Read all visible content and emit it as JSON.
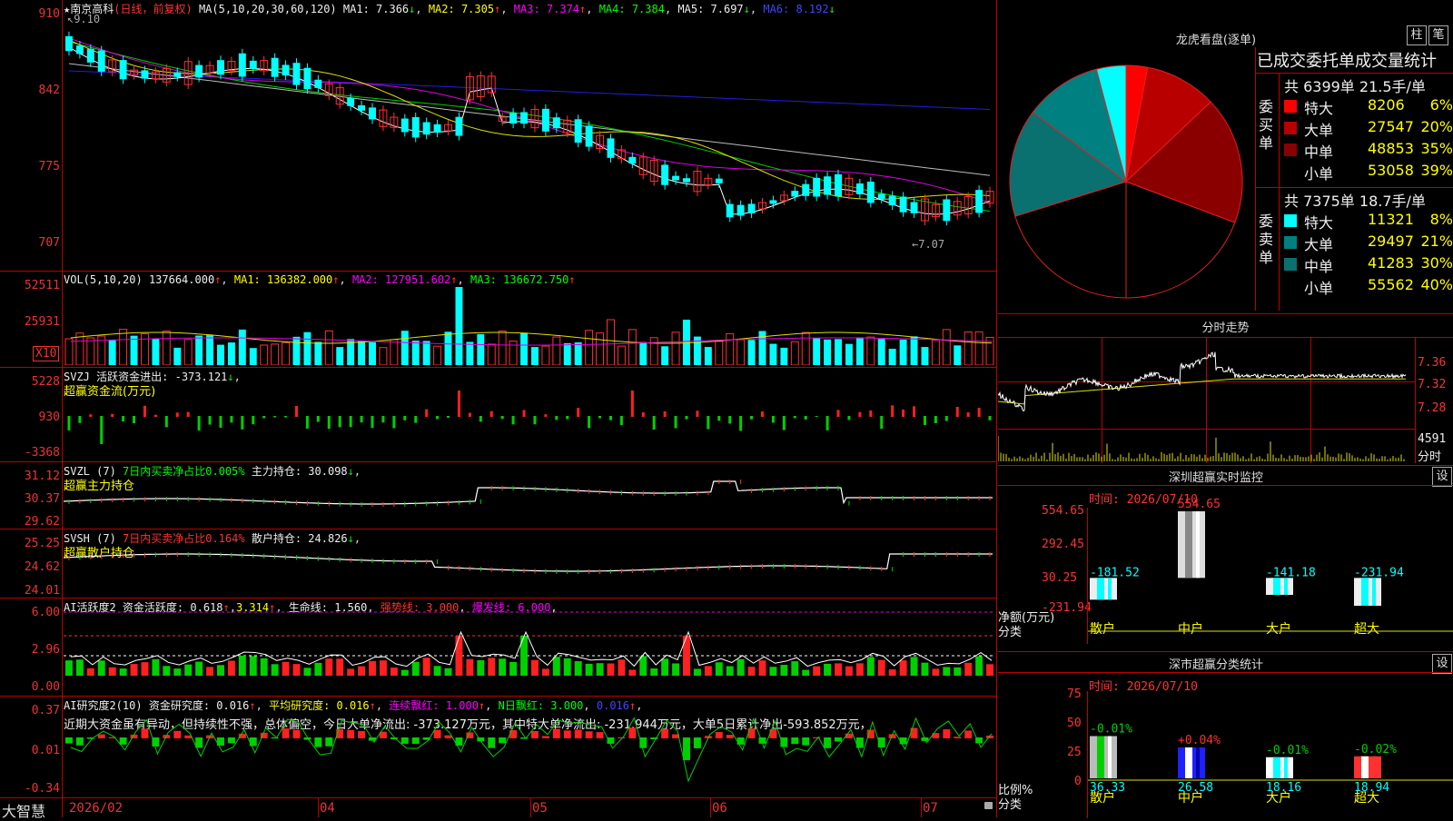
{
  "main_chart": {
    "star": "★",
    "stock_name": "南京高科",
    "period_label": "(日线，前复权)",
    "ma_params": "MA(5,10,20,30,60,120)",
    "ma1": "MA1: 7.366",
    "ma2": "MA2: 7.305",
    "ma3": "MA3: 7.374",
    "ma4": "MA4: 7.384",
    "ma5": "MA5: 7.697",
    "ma6": "MA6: 8.192",
    "high_mark": "9.10",
    "low_mark": "7.07",
    "y_ticks": [
      "910",
      "842",
      "775",
      "707"
    ]
  },
  "vol_chart": {
    "label": "VOL(5,10,20)",
    "value": "137664.000",
    "ma1": "MA1: 136382.000",
    "ma2": "MA2: 127951.602",
    "ma3": "MA3: 136672.750",
    "y_ticks": [
      "52511",
      "25931"
    ],
    "unit": "X10"
  },
  "svzj": {
    "label": "SVZJ",
    "text": "活跃资金进出: -373.121",
    "subtitle": "超赢资金流(万元)",
    "y_ticks": [
      "5228",
      "930",
      "-3368"
    ]
  },
  "svzl": {
    "label": "SVZL (7)",
    "text1": "7日内买卖净占比0.005%",
    "text2": "主力持仓: 30.098",
    "subtitle": "超赢主力持仓",
    "y_ticks": [
      "31.12",
      "30.37",
      "29.62"
    ]
  },
  "svsh": {
    "label": "SVSH (7)",
    "text1": "7日内买卖净占比0.164%",
    "text2": "散户持仓: 24.826",
    "subtitle": "超赢散户持仓",
    "y_ticks": [
      "25.25",
      "24.62",
      "24.01"
    ]
  },
  "ai_active": {
    "label": "AI活跃度2",
    "text1": "资金活跃度: 0.618",
    "text2": "3.314",
    "text3": "生命线: 1.560",
    "text4": "强势线: 3.000",
    "text5": "爆发线: 6.000",
    "y_ticks": [
      "6.00",
      "2.96",
      "0.00"
    ]
  },
  "ai_research": {
    "label": "AI研究度2(10)",
    "text1": "资金研究度: 0.016",
    "text2": "平均研究度: 0.016",
    "text3": "连续飘红: 1.000",
    "text4": "N日飘红: 3.000",
    "text5": "0.016",
    "commentary": "近期大资金虽有异动，但持续性不强，总体偏空，今日大单净流出: -373.127万元，其中特大单净流出: -231.944万元，大单5日累计净出-593.852万元，",
    "y_ticks": [
      "0.37",
      "0.01",
      "-0.34"
    ]
  },
  "x_axis": {
    "brand": "大智慧",
    "labels": [
      "2026/02",
      "04",
      "05",
      "06",
      "07"
    ]
  },
  "dragon_tiger": {
    "title": "龙虎看盘(逐单)",
    "btn_bar": "柱",
    "btn_pen": "笔",
    "stats_title": "已成交委托单成交量统计",
    "buy_label": "委买单",
    "sell_label": "委卖单",
    "buy_total": "共 6399单 21.5手/单",
    "sell_total": "共 7375单 18.7手/单",
    "buy_rows": [
      {
        "name": "特大",
        "vol": "8206",
        "pct": "6%",
        "color": "#ff0000"
      },
      {
        "name": "大单",
        "vol": "27547",
        "pct": "20%",
        "color": "#b80000"
      },
      {
        "name": "中单",
        "vol": "48853",
        "pct": "35%",
        "color": "#8a0000"
      },
      {
        "name": "小单",
        "vol": "53058",
        "pct": "39%",
        "color": "#000000"
      }
    ],
    "sell_rows": [
      {
        "name": "特大",
        "vol": "11321",
        "pct": "8%",
        "color": "#00ffff"
      },
      {
        "name": "大单",
        "vol": "29497",
        "pct": "21%",
        "color": "#008080"
      },
      {
        "name": "中单",
        "vol": "41283",
        "pct": "30%",
        "color": "#0a7070"
      },
      {
        "name": "小单",
        "vol": "55562",
        "pct": "40%",
        "color": "#000000"
      }
    ]
  },
  "intraday": {
    "title": "分时走势",
    "y_ticks": [
      "7.36",
      "7.32",
      "7.28"
    ],
    "vol_tick": "4591",
    "vol_label": "分时"
  },
  "sz_monitor": {
    "title": "深圳超赢实时监控",
    "btn": "设",
    "time": "时间: 2026/07/10",
    "y_ticks": [
      "554.65",
      "292.45",
      "30.25",
      "-231.94"
    ],
    "axis_label1": "净额(万元)",
    "axis_label2": "分类",
    "categories": [
      "散户",
      "中户",
      "大户",
      "超大"
    ],
    "values": [
      "-181.52",
      "554.65",
      "-141.18",
      "-231.94"
    ]
  },
  "sz_class": {
    "title": "深市超赢分类统计",
    "btn": "设",
    "time": "时间: 2026/07/10",
    "y_ticks": [
      "75",
      "50",
      "25",
      "0"
    ],
    "axis_label1": "比例%",
    "axis_label2": "分类",
    "categories": [
      "散户",
      "中户",
      "大户",
      "超大"
    ],
    "changes": [
      "-0.01%",
      "+0.04%",
      "-0.01%",
      "-0.02%"
    ],
    "values": [
      "36.33",
      "26.58",
      "18.16",
      "18.94"
    ]
  },
  "chart_data": [
    {
      "type": "pie",
      "title": "龙虎看盘(逐单)",
      "categories": [
        "买特大",
        "买大单",
        "买中单",
        "买小单",
        "卖小单",
        "卖中单",
        "卖大单",
        "卖特大"
      ],
      "values": [
        8206,
        27547,
        48853,
        53058,
        55562,
        41283,
        29497,
        11321
      ]
    },
    {
      "type": "bar",
      "title": "深圳超赢实时监控",
      "categories": [
        "散户",
        "中户",
        "大户",
        "超大"
      ],
      "values": [
        -181.52,
        554.65,
        -141.18,
        -231.94
      ],
      "ylabel": "净额(万元)",
      "ylim": [
        -231.94,
        554.65
      ]
    },
    {
      "type": "bar",
      "title": "深市超赢分类统计",
      "categories": [
        "散户",
        "中户",
        "大户",
        "超大"
      ],
      "values": [
        36.33,
        26.58,
        18.16,
        18.94
      ],
      "ylabel": "比例%",
      "ylim": [
        0,
        75
      ]
    }
  ]
}
